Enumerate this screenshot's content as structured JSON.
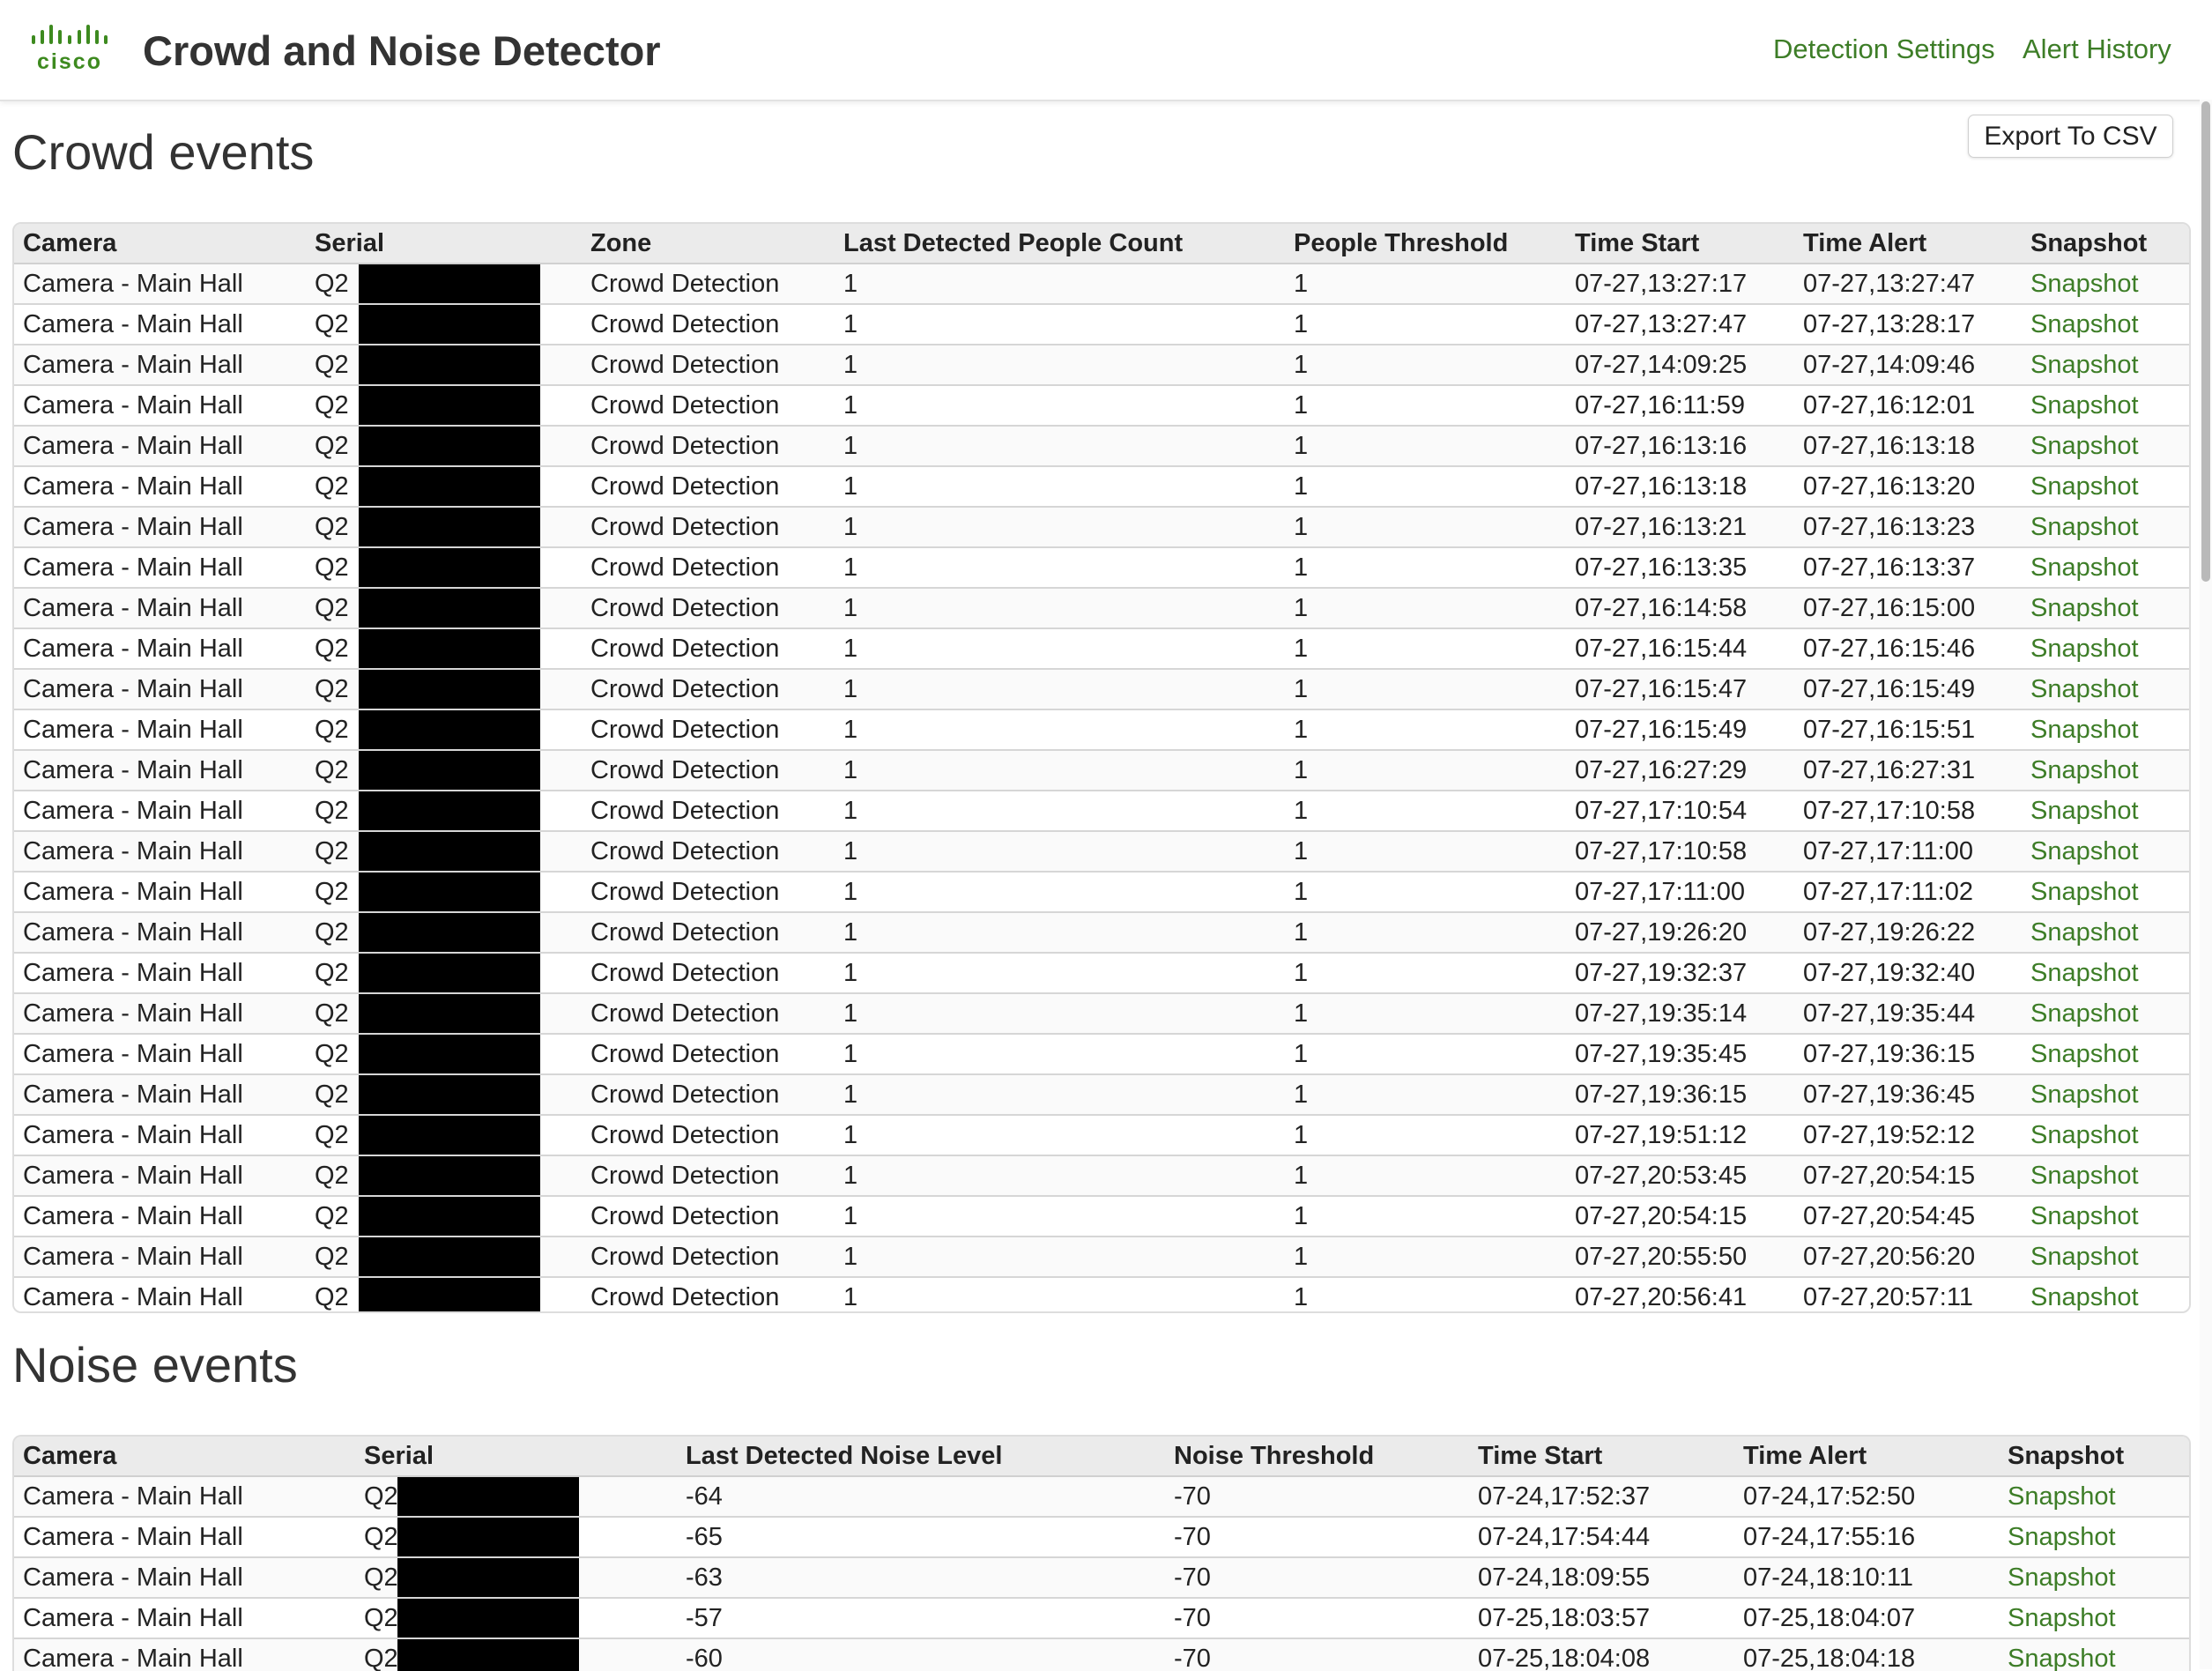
{
  "header": {
    "logo_text": "cisco",
    "title": "Crowd and Noise Detector",
    "nav": {
      "detection_settings": "Detection Settings",
      "alert_history": "Alert History"
    }
  },
  "colors": {
    "accent": "#3d7d27",
    "redaction": "#000000"
  },
  "crowd": {
    "title": "Crowd events",
    "export_label": "Export To CSV",
    "columns": [
      "Camera",
      "Serial",
      "Zone",
      "Last Detected People Count",
      "People Threshold",
      "Time Start",
      "Time Alert",
      "Snapshot"
    ],
    "rows": [
      {
        "camera": "Camera - Main Hall",
        "serial": "Q2",
        "zone": "Crowd Detection",
        "count": "1",
        "threshold": "1",
        "start": "07-27,13:27:17",
        "alert": "07-27,13:27:47",
        "snapshot": "Snapshot"
      },
      {
        "camera": "Camera - Main Hall",
        "serial": "Q2",
        "zone": "Crowd Detection",
        "count": "1",
        "threshold": "1",
        "start": "07-27,13:27:47",
        "alert": "07-27,13:28:17",
        "snapshot": "Snapshot"
      },
      {
        "camera": "Camera - Main Hall",
        "serial": "Q2",
        "zone": "Crowd Detection",
        "count": "1",
        "threshold": "1",
        "start": "07-27,14:09:25",
        "alert": "07-27,14:09:46",
        "snapshot": "Snapshot"
      },
      {
        "camera": "Camera - Main Hall",
        "serial": "Q2",
        "zone": "Crowd Detection",
        "count": "1",
        "threshold": "1",
        "start": "07-27,16:11:59",
        "alert": "07-27,16:12:01",
        "snapshot": "Snapshot"
      },
      {
        "camera": "Camera - Main Hall",
        "serial": "Q2",
        "zone": "Crowd Detection",
        "count": "1",
        "threshold": "1",
        "start": "07-27,16:13:16",
        "alert": "07-27,16:13:18",
        "snapshot": "Snapshot"
      },
      {
        "camera": "Camera - Main Hall",
        "serial": "Q2",
        "zone": "Crowd Detection",
        "count": "1",
        "threshold": "1",
        "start": "07-27,16:13:18",
        "alert": "07-27,16:13:20",
        "snapshot": "Snapshot"
      },
      {
        "camera": "Camera - Main Hall",
        "serial": "Q2",
        "zone": "Crowd Detection",
        "count": "1",
        "threshold": "1",
        "start": "07-27,16:13:21",
        "alert": "07-27,16:13:23",
        "snapshot": "Snapshot"
      },
      {
        "camera": "Camera - Main Hall",
        "serial": "Q2",
        "zone": "Crowd Detection",
        "count": "1",
        "threshold": "1",
        "start": "07-27,16:13:35",
        "alert": "07-27,16:13:37",
        "snapshot": "Snapshot"
      },
      {
        "camera": "Camera - Main Hall",
        "serial": "Q2",
        "zone": "Crowd Detection",
        "count": "1",
        "threshold": "1",
        "start": "07-27,16:14:58",
        "alert": "07-27,16:15:00",
        "snapshot": "Snapshot"
      },
      {
        "camera": "Camera - Main Hall",
        "serial": "Q2",
        "zone": "Crowd Detection",
        "count": "1",
        "threshold": "1",
        "start": "07-27,16:15:44",
        "alert": "07-27,16:15:46",
        "snapshot": "Snapshot"
      },
      {
        "camera": "Camera - Main Hall",
        "serial": "Q2",
        "zone": "Crowd Detection",
        "count": "1",
        "threshold": "1",
        "start": "07-27,16:15:47",
        "alert": "07-27,16:15:49",
        "snapshot": "Snapshot"
      },
      {
        "camera": "Camera - Main Hall",
        "serial": "Q2",
        "zone": "Crowd Detection",
        "count": "1",
        "threshold": "1",
        "start": "07-27,16:15:49",
        "alert": "07-27,16:15:51",
        "snapshot": "Snapshot"
      },
      {
        "camera": "Camera - Main Hall",
        "serial": "Q2",
        "zone": "Crowd Detection",
        "count": "1",
        "threshold": "1",
        "start": "07-27,16:27:29",
        "alert": "07-27,16:27:31",
        "snapshot": "Snapshot"
      },
      {
        "camera": "Camera - Main Hall",
        "serial": "Q2",
        "zone": "Crowd Detection",
        "count": "1",
        "threshold": "1",
        "start": "07-27,17:10:54",
        "alert": "07-27,17:10:58",
        "snapshot": "Snapshot"
      },
      {
        "camera": "Camera - Main Hall",
        "serial": "Q2",
        "zone": "Crowd Detection",
        "count": "1",
        "threshold": "1",
        "start": "07-27,17:10:58",
        "alert": "07-27,17:11:00",
        "snapshot": "Snapshot"
      },
      {
        "camera": "Camera - Main Hall",
        "serial": "Q2",
        "zone": "Crowd Detection",
        "count": "1",
        "threshold": "1",
        "start": "07-27,17:11:00",
        "alert": "07-27,17:11:02",
        "snapshot": "Snapshot"
      },
      {
        "camera": "Camera - Main Hall",
        "serial": "Q2",
        "zone": "Crowd Detection",
        "count": "1",
        "threshold": "1",
        "start": "07-27,19:26:20",
        "alert": "07-27,19:26:22",
        "snapshot": "Snapshot"
      },
      {
        "camera": "Camera - Main Hall",
        "serial": "Q2",
        "zone": "Crowd Detection",
        "count": "1",
        "threshold": "1",
        "start": "07-27,19:32:37",
        "alert": "07-27,19:32:40",
        "snapshot": "Snapshot"
      },
      {
        "camera": "Camera - Main Hall",
        "serial": "Q2",
        "zone": "Crowd Detection",
        "count": "1",
        "threshold": "1",
        "start": "07-27,19:35:14",
        "alert": "07-27,19:35:44",
        "snapshot": "Snapshot"
      },
      {
        "camera": "Camera - Main Hall",
        "serial": "Q2",
        "zone": "Crowd Detection",
        "count": "1",
        "threshold": "1",
        "start": "07-27,19:35:45",
        "alert": "07-27,19:36:15",
        "snapshot": "Snapshot"
      },
      {
        "camera": "Camera - Main Hall",
        "serial": "Q2",
        "zone": "Crowd Detection",
        "count": "1",
        "threshold": "1",
        "start": "07-27,19:36:15",
        "alert": "07-27,19:36:45",
        "snapshot": "Snapshot"
      },
      {
        "camera": "Camera - Main Hall",
        "serial": "Q2",
        "zone": "Crowd Detection",
        "count": "1",
        "threshold": "1",
        "start": "07-27,19:51:12",
        "alert": "07-27,19:52:12",
        "snapshot": "Snapshot"
      },
      {
        "camera": "Camera - Main Hall",
        "serial": "Q2",
        "zone": "Crowd Detection",
        "count": "1",
        "threshold": "1",
        "start": "07-27,20:53:45",
        "alert": "07-27,20:54:15",
        "snapshot": "Snapshot"
      },
      {
        "camera": "Camera - Main Hall",
        "serial": "Q2",
        "zone": "Crowd Detection",
        "count": "1",
        "threshold": "1",
        "start": "07-27,20:54:15",
        "alert": "07-27,20:54:45",
        "snapshot": "Snapshot"
      },
      {
        "camera": "Camera - Main Hall",
        "serial": "Q2",
        "zone": "Crowd Detection",
        "count": "1",
        "threshold": "1",
        "start": "07-27,20:55:50",
        "alert": "07-27,20:56:20",
        "snapshot": "Snapshot"
      },
      {
        "camera": "Camera - Main Hall",
        "serial": "Q2",
        "zone": "Crowd Detection",
        "count": "1",
        "threshold": "1",
        "start": "07-27,20:56:41",
        "alert": "07-27,20:57:11",
        "snapshot": "Snapshot"
      }
    ]
  },
  "noise": {
    "title": "Noise events",
    "columns": [
      "Camera",
      "Serial",
      "Last Detected Noise Level",
      "Noise Threshold",
      "Time Start",
      "Time Alert",
      "Snapshot"
    ],
    "rows": [
      {
        "camera": "Camera - Main Hall",
        "serial": "Q2C",
        "level": "-64",
        "threshold": "-70",
        "start": "07-24,17:52:37",
        "alert": "07-24,17:52:50",
        "snapshot": "Snapshot"
      },
      {
        "camera": "Camera - Main Hall",
        "serial": "Q2C",
        "level": "-65",
        "threshold": "-70",
        "start": "07-24,17:54:44",
        "alert": "07-24,17:55:16",
        "snapshot": "Snapshot"
      },
      {
        "camera": "Camera - Main Hall",
        "serial": "Q2C",
        "level": "-63",
        "threshold": "-70",
        "start": "07-24,18:09:55",
        "alert": "07-24,18:10:11",
        "snapshot": "Snapshot"
      },
      {
        "camera": "Camera - Main Hall",
        "serial": "Q2C",
        "level": "-57",
        "threshold": "-70",
        "start": "07-25,18:03:57",
        "alert": "07-25,18:04:07",
        "snapshot": "Snapshot"
      },
      {
        "camera": "Camera - Main Hall",
        "serial": "Q2C",
        "level": "-60",
        "threshold": "-70",
        "start": "07-25,18:04:08",
        "alert": "07-25,18:04:18",
        "snapshot": "Snapshot"
      }
    ]
  }
}
